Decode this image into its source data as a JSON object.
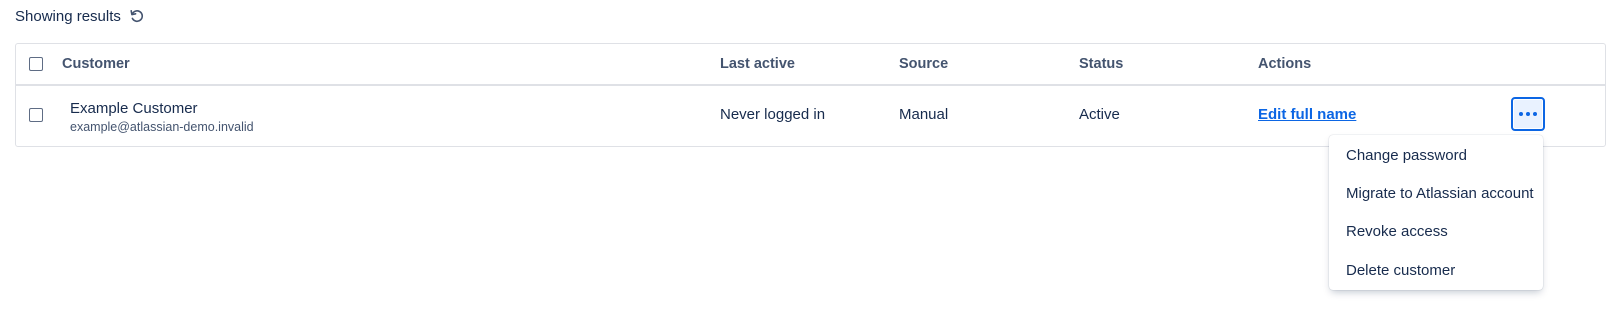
{
  "results": {
    "label": "Showing results",
    "refresh_icon": "refresh-icon"
  },
  "table": {
    "columns": {
      "customer": "Customer",
      "last_active": "Last active",
      "source": "Source",
      "status": "Status",
      "actions": "Actions"
    },
    "rows": [
      {
        "name": "Example Customer",
        "email": "example@atlassian-demo.invalid",
        "last_active": "Never logged in",
        "source": "Manual",
        "status": "Active",
        "action_link": "Edit full name"
      }
    ]
  },
  "menu": {
    "items": [
      "Change password",
      "Migrate to Atlassian account",
      "Revoke access",
      "Delete customer"
    ]
  },
  "colors": {
    "accent": "#0c66e4",
    "text": "#172b4d",
    "subtle": "#44546f",
    "border": "#dfe1e6"
  }
}
